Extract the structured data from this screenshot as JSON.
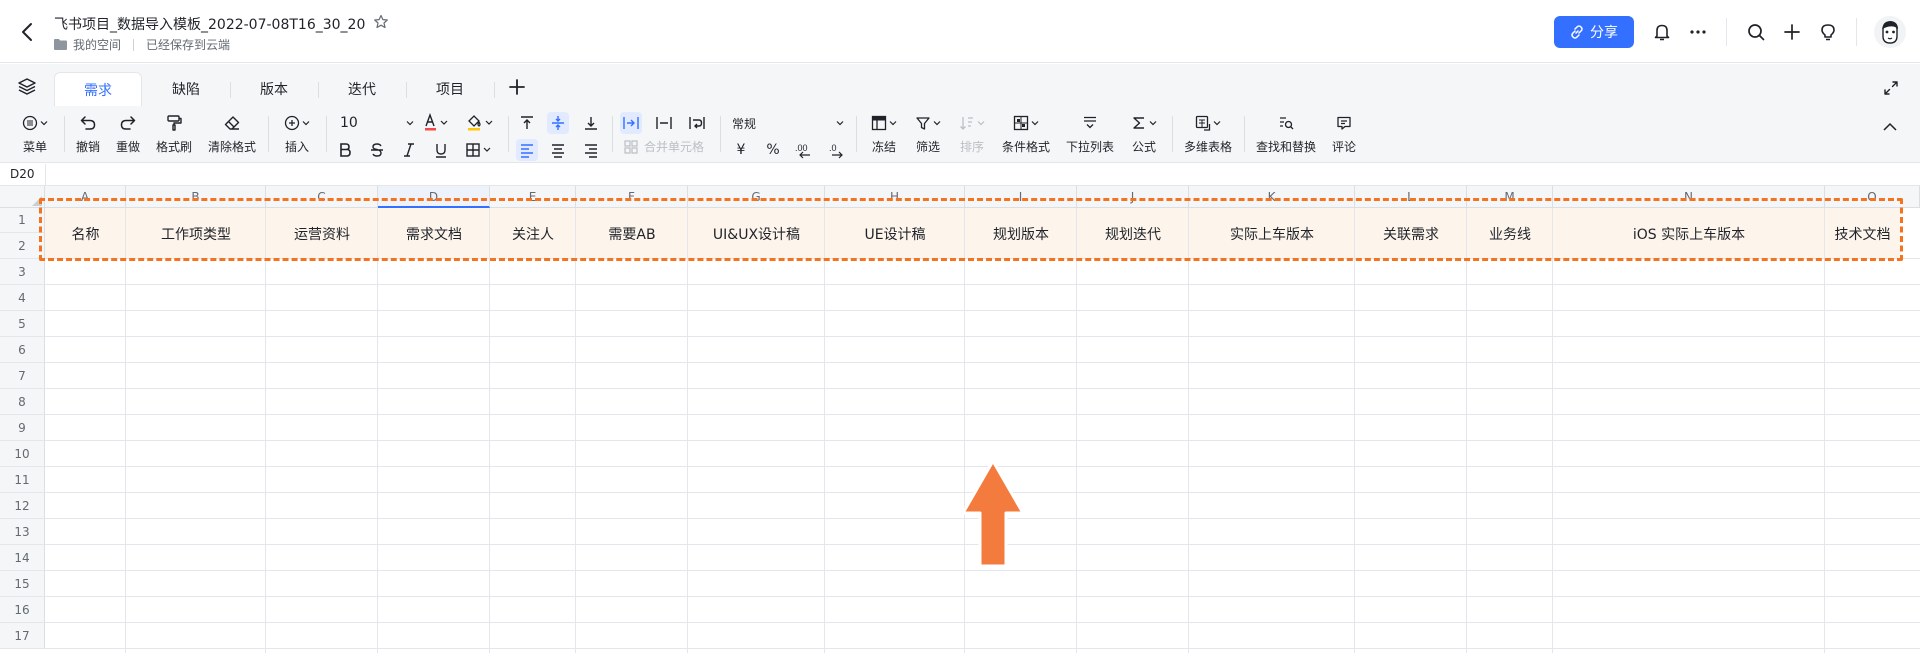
{
  "titlebar": {
    "doc_title": "飞书项目_数据导入模板_2022-07-08T16_30_20",
    "crumb_location": "我的空间",
    "crumb_status": "已经保存到云端",
    "share_label": "分享"
  },
  "tabs": [
    {
      "label": "需求",
      "active": true
    },
    {
      "label": "缺陷"
    },
    {
      "label": "版本"
    },
    {
      "label": "迭代"
    },
    {
      "label": "项目"
    }
  ],
  "toolbar": {
    "menu": "菜单",
    "undo": "撤销",
    "redo": "重做",
    "format_painter": "格式刷",
    "clear_format": "清除格式",
    "insert": "插入",
    "font_size": "10",
    "merge_cells": "合并单元格",
    "number_format": "常规",
    "currency": "¥",
    "percent": "%",
    "freeze": "冻结",
    "filter": "筛选",
    "sort": "排序",
    "conditional_format": "条件格式",
    "dropdown_list": "下拉列表",
    "formula": "公式",
    "multi_table": "多维表格",
    "find_replace": "查找和替换",
    "comment": "评论"
  },
  "formula_bar": {
    "cell_ref": "D20"
  },
  "columns": [
    "A",
    "B",
    "C",
    "D",
    "E",
    "F",
    "G",
    "H",
    "I",
    "J",
    "K",
    "L",
    "M",
    "N",
    "O"
  ],
  "rows": [
    "1",
    "2",
    "3",
    "4",
    "5",
    "6",
    "7",
    "8",
    "9",
    "10",
    "11",
    "12",
    "13",
    "14",
    "15",
    "16",
    "17"
  ],
  "header_cells": [
    "名称",
    "工作项类型",
    "运营资料",
    "需求文档",
    "关注人",
    "需要AB",
    "UI&UX设计稿",
    "UE设计稿",
    "规划版本",
    "规划迭代",
    "实际上车版本",
    "关联需求",
    "业务线",
    "iOS 实际上车版本",
    "技术文档"
  ],
  "colors": {
    "accent": "#3370ff",
    "highlight": "#f4731f",
    "arrow": "#f47b3e",
    "header_fill": "#fdf4ec"
  }
}
